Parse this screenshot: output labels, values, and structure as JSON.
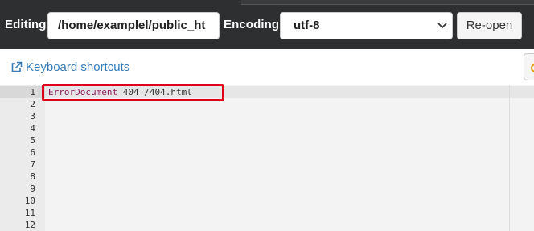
{
  "toolbar": {
    "editing_label": "Editing:",
    "path_value": "/home/examplel/public_ht",
    "encoding_label": "Encoding:",
    "encoding_value": "utf-8",
    "reopen_label": "Re-open"
  },
  "subbar": {
    "keyboard_shortcuts_label": "Keyboard shortcuts"
  },
  "editor": {
    "line_numbers": [
      "1",
      "2",
      "3",
      "4",
      "5",
      "6",
      "7",
      "8",
      "9",
      "10",
      "11",
      "12"
    ],
    "line1_keyword": "ErrorDocument",
    "line1_rest": " 404 /404.html",
    "keyword_color": "#8e1c5c",
    "highlight_color": "#e0001a"
  }
}
